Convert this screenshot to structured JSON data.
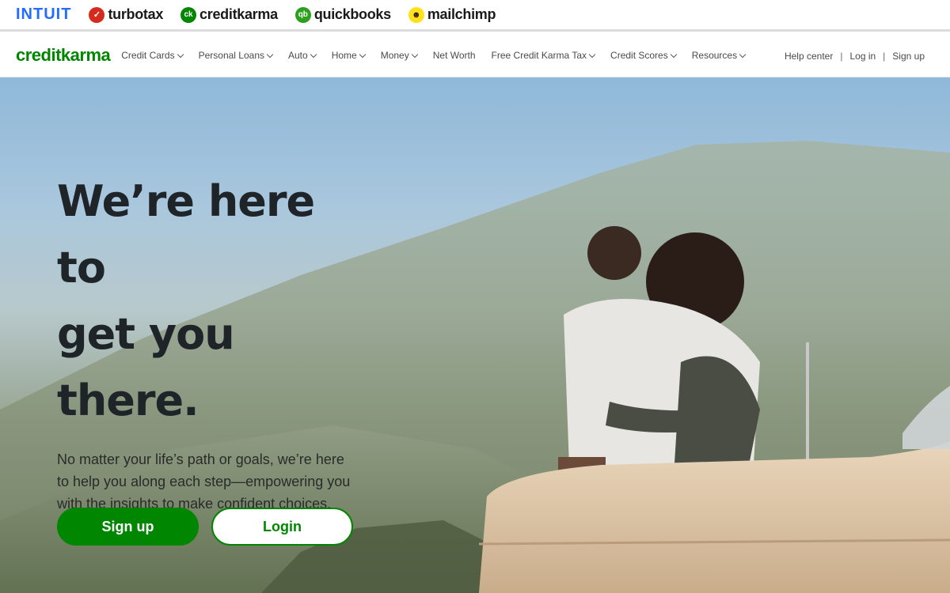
{
  "brandbar": {
    "intuit": "INTUIT",
    "turbotax": "turbotax",
    "creditkarma": "creditkarma",
    "quickbooks": "quickbooks",
    "mailchimp": "mailchimp"
  },
  "nav": {
    "logo": "creditkarma",
    "links": [
      {
        "label": "Credit Cards"
      },
      {
        "label": "Personal Loans"
      },
      {
        "label": "Auto"
      },
      {
        "label": "Home"
      },
      {
        "label": "Money"
      },
      {
        "label": "Net Worth"
      },
      {
        "label": "Free Credit Karma Tax"
      },
      {
        "label": "Credit Scores"
      },
      {
        "label": "Resources"
      }
    ],
    "help": "Help center",
    "login": "Log in",
    "signup": "Sign up"
  },
  "hero": {
    "headline_line1": "We’re here to",
    "headline_line2": "get you",
    "headline_line3": "there.",
    "subcopy": "No matter your life’s path or goals, we’re here to help you along each step—empowering you with the insights to make confident choices.",
    "primary_cta": "Sign up",
    "secondary_cta": "Login"
  },
  "colors": {
    "brand_green": "#008600",
    "intuit_blue": "#236cff",
    "headline": "#1f2428"
  }
}
